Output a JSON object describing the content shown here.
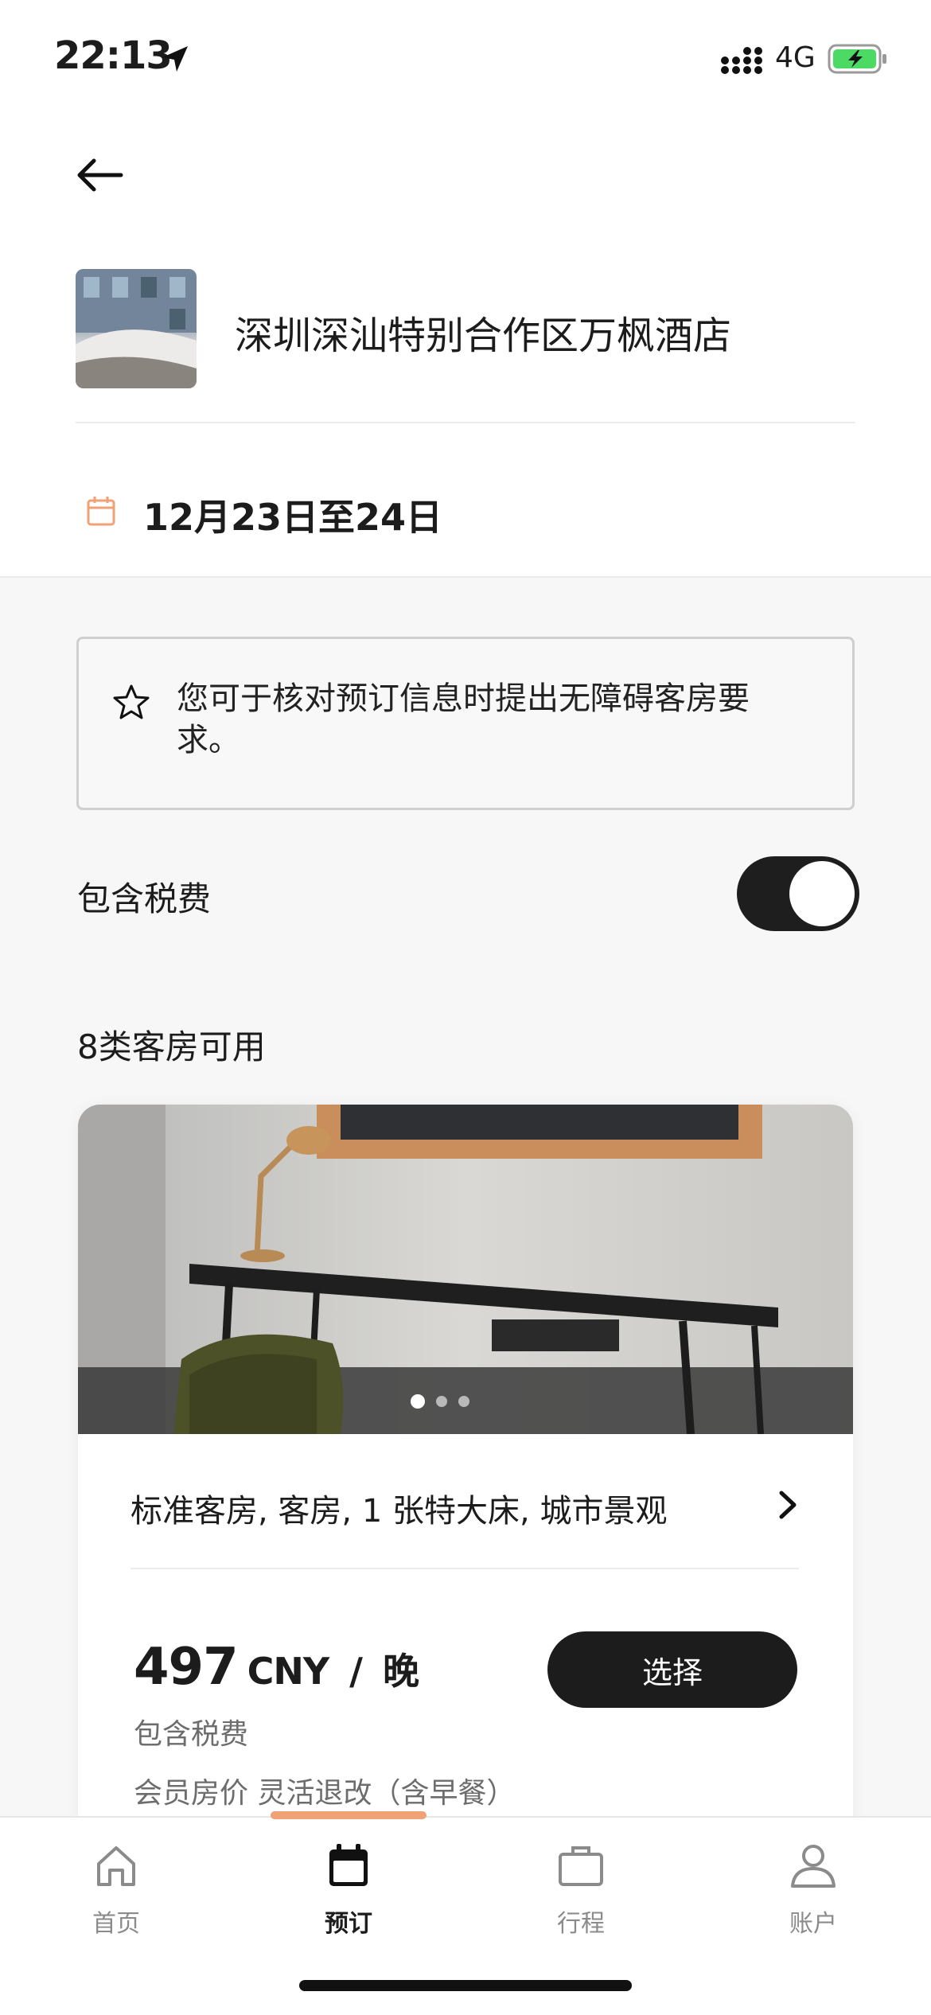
{
  "status_bar": {
    "time": "22:13",
    "network": "4G"
  },
  "hotel": {
    "name": "深圳深汕特别合作区万枫酒店",
    "dates": "12月23日至24日"
  },
  "notice": {
    "text": "您可于核对预订信息时提出无障碍客房要求。"
  },
  "tax_toggle": {
    "label": "包含税费",
    "on": true
  },
  "rooms_available": "8类客房可用",
  "room_card": {
    "name": "标准客房, 客房, 1 张特大床, 城市景观",
    "price": "497",
    "currency": "CNY",
    "separator": "/",
    "unit": "晚",
    "price_note": "包含税费",
    "rate_note": "会员房价 灵活退改（含早餐）",
    "select_label": "选择",
    "photo_index": 1,
    "photo_count": 3
  },
  "tabs": [
    {
      "label": "首页",
      "icon": "home-icon"
    },
    {
      "label": "预订",
      "icon": "calendar-icon"
    },
    {
      "label": "行程",
      "icon": "briefcase-icon"
    },
    {
      "label": "账户",
      "icon": "person-icon"
    }
  ],
  "active_tab": 1,
  "colors": {
    "accent": "#f0a176",
    "dark": "#1c1c1c",
    "battery": "#4cd964"
  }
}
